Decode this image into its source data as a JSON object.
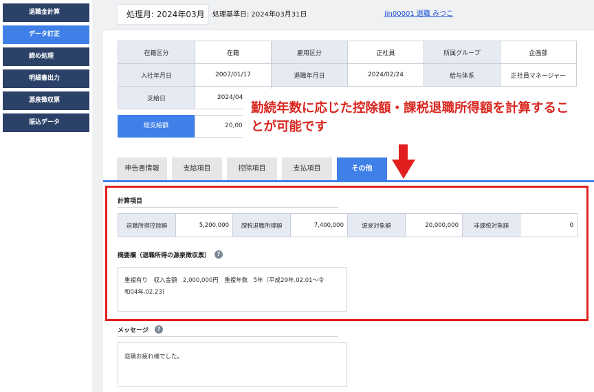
{
  "sidebar": {
    "items": [
      {
        "label": "退職金計算"
      },
      {
        "label": "データ訂正"
      },
      {
        "label": "締め処理"
      },
      {
        "label": "明細書出力"
      },
      {
        "label": "源泉徴収票"
      },
      {
        "label": "振込データ"
      }
    ]
  },
  "header": {
    "month": "処理月: 2024年03月",
    "base_date": "処理基準日: 2024年03月31日",
    "user": "jin00001 退職 みつこ"
  },
  "info": {
    "row1": [
      "在籍区分",
      "在籍",
      "雇用区分",
      "正社員",
      "所属グループ",
      "企画部"
    ],
    "row2": [
      "入社年月日",
      "2007/01/17",
      "退職年月日",
      "2024/02/24",
      "給与体系",
      "正社員マネージャー"
    ],
    "row3": [
      "支給日",
      "2024/04/3"
    ],
    "total_label": "総支給額",
    "total_value": "20,000"
  },
  "callout": {
    "text": "勤続年数に応じた控除額・課税退職所得額を計算することが可能です",
    "color": "#d9271f"
  },
  "tabs": [
    {
      "label": "申告書情報"
    },
    {
      "label": "支給項目"
    },
    {
      "label": "控除項目"
    },
    {
      "label": "支払項目"
    },
    {
      "label": "その他"
    }
  ],
  "calc": {
    "title": "計算項目",
    "cells": [
      "退職所得控除額",
      "5,200,000",
      "課税退職所得額",
      "7,400,000",
      "源泉対象額",
      "20,000,000",
      "非課税対象額",
      "0"
    ]
  },
  "summary": {
    "title": "摘要欄（退職所得の源泉徴収票）",
    "line1": "重複有り　収入金額　2,000,000円　重複年数　5年（平成29年.02.01～令",
    "line2": "和04年.02.23)"
  },
  "message": {
    "title": "メッセージ",
    "text": "退職お疲れ様でした。"
  },
  "colors": {
    "accent": "#3e7fe8",
    "sidebar": "#2c4168",
    "highlight": "#e21f1f"
  }
}
